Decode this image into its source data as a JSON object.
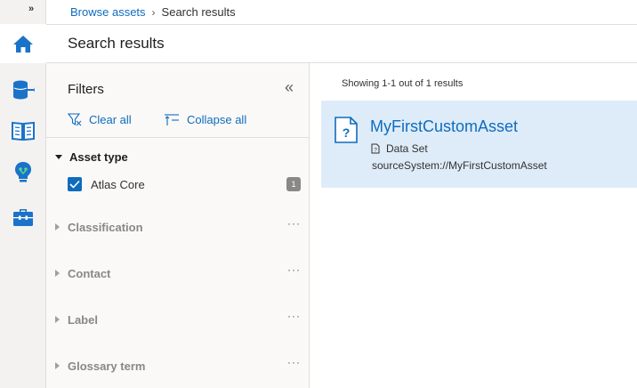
{
  "rail": {
    "expand_label": "»",
    "items": [
      {
        "name": "home-icon"
      },
      {
        "name": "data-sources-icon"
      },
      {
        "name": "glossary-icon"
      },
      {
        "name": "insights-icon"
      },
      {
        "name": "management-icon"
      }
    ]
  },
  "breadcrumb": {
    "parent": "Browse assets",
    "separator": "›",
    "current": "Search results"
  },
  "page": {
    "title": "Search results"
  },
  "filters": {
    "title": "Filters",
    "collapse_panel_label": "«",
    "clear_all": "Clear all",
    "collapse_all": "Collapse all",
    "asset_type": {
      "label": "Asset type",
      "options": [
        {
          "label": "Atlas Core",
          "count": "1",
          "checked": true
        }
      ]
    },
    "facets": [
      {
        "label": "Classification",
        "more": "···"
      },
      {
        "label": "Contact",
        "more": "···"
      },
      {
        "label": "Label",
        "more": "···"
      },
      {
        "label": "Glossary term",
        "more": "···"
      }
    ]
  },
  "results": {
    "summary": "Showing 1-1 out of 1 results",
    "items": [
      {
        "title": "MyFirstCustomAsset",
        "type": "Data Set",
        "path": "sourceSystem://MyFirstCustomAsset",
        "icon": "unknown-asset-icon"
      }
    ]
  },
  "colors": {
    "accent": "#0f6cbd",
    "selected_bg": "#deecf9",
    "rail_bg": "#f3f2f1",
    "panel_bg": "#faf9f8"
  }
}
